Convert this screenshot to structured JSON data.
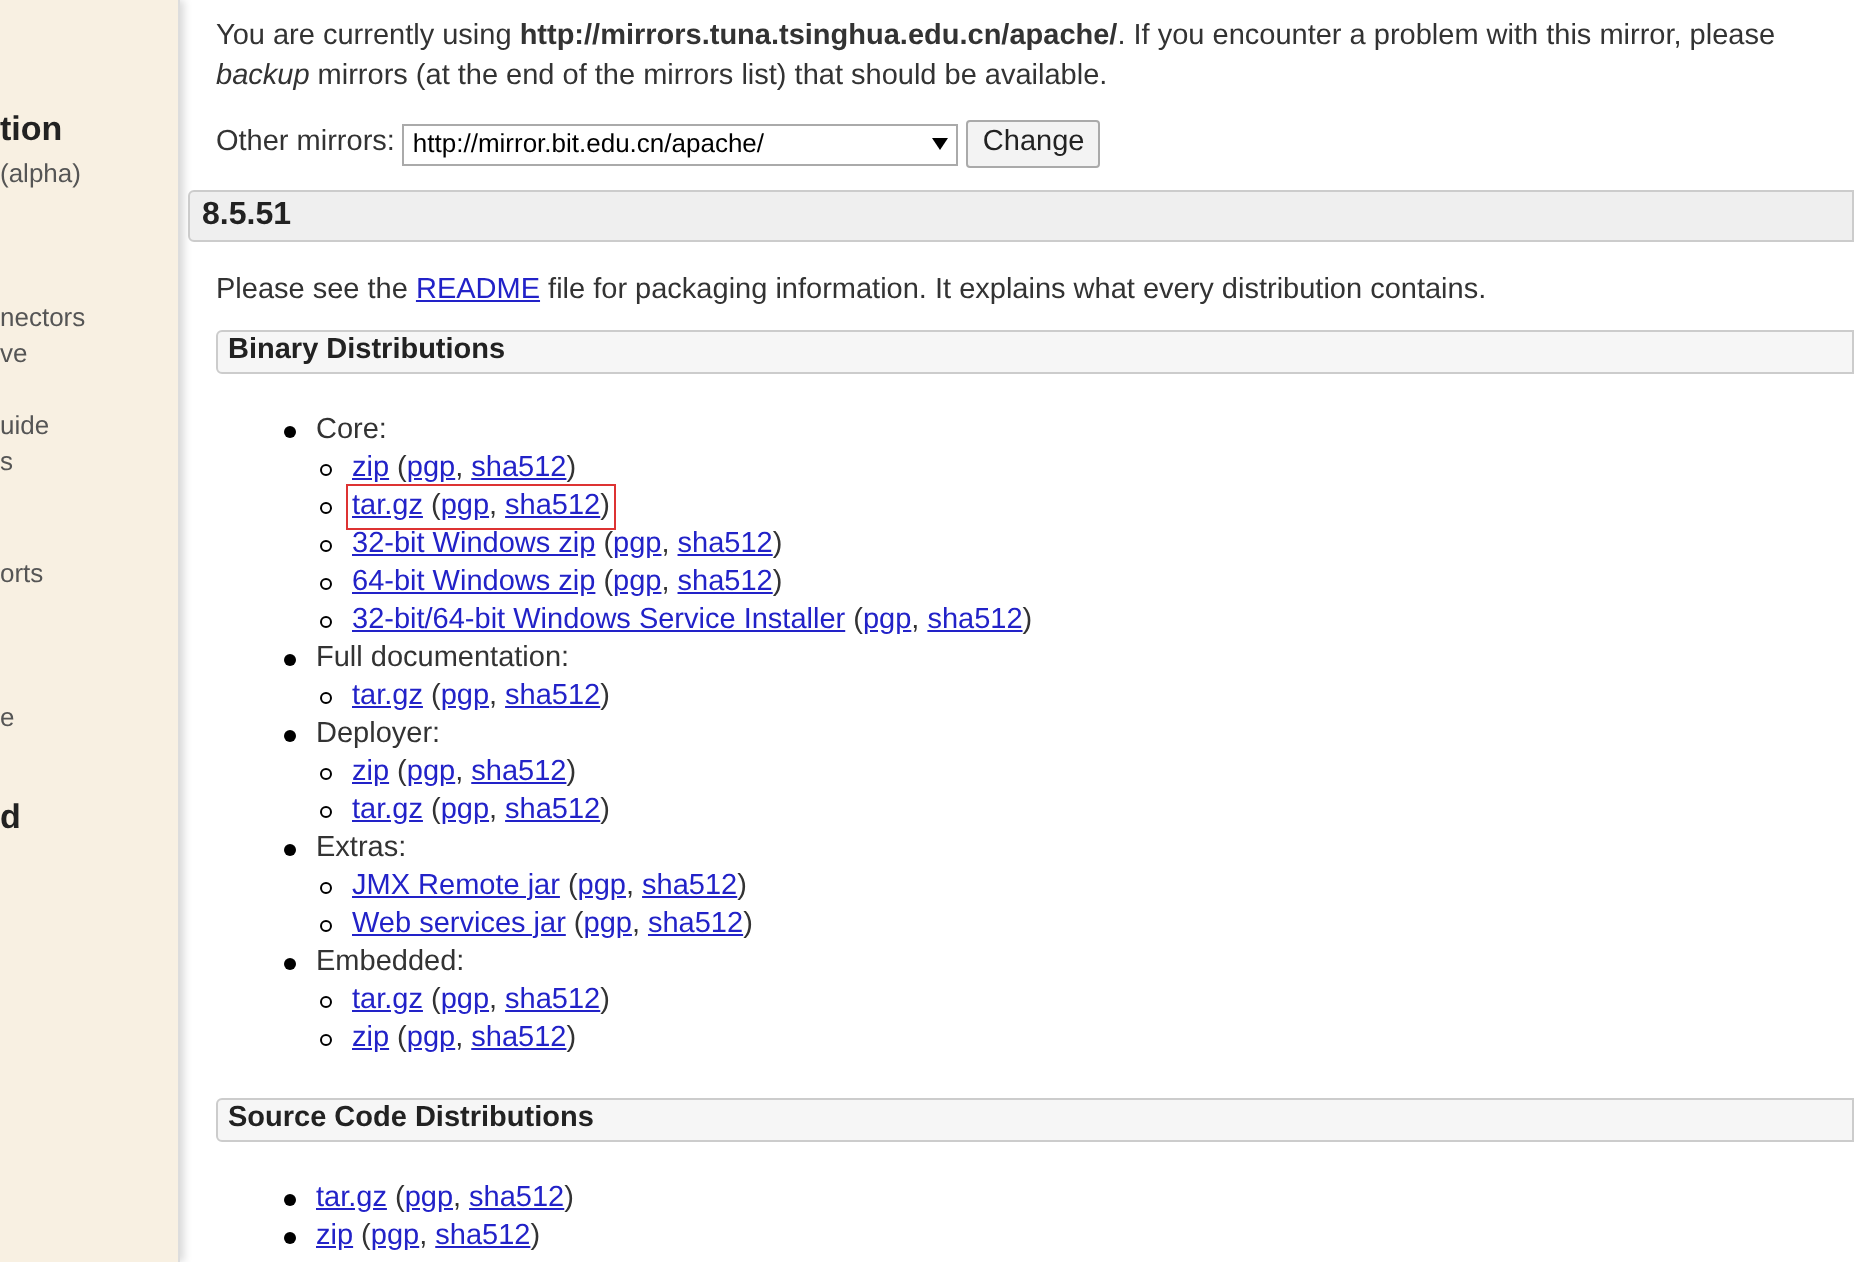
{
  "sidebar": {
    "items": [
      {
        "text": "tion",
        "kind": "heading"
      },
      {
        "text": "(alpha)",
        "kind": "link"
      },
      {
        "text": "nectors",
        "kind": "link"
      },
      {
        "text": "ve",
        "kind": "link"
      },
      {
        "text": "uide",
        "kind": "link"
      },
      {
        "text": "s",
        "kind": "link"
      },
      {
        "text": "orts",
        "kind": "link"
      },
      {
        "text": "e",
        "kind": "link"
      },
      {
        "text": "d",
        "kind": "heading"
      }
    ]
  },
  "intro": "You are currently using **http://mirrors.tuna.tsinghua.edu.cn/apache/**. If you encounter a problem with this mirror, please",
  "intro_2": "*backup* mirrors (at the end of the mirrors list) that should be available.",
  "mirror_select": {
    "label": "Other mirrors:",
    "value": "http://mirror.bit.edu.cn/apache/",
    "button": "Change"
  },
  "version": "8.5.51",
  "readme": {
    "before": "Please see the",
    "link": "README",
    "after": "file for packaging information. It explains what every distribution contains."
  },
  "sections": [
    {
      "title": "Binary Distributions",
      "groups": [
        {
          "label": "Core:",
          "files": [
            {
              "label": "zip",
              "open": "(",
              "links": [
                "pgp",
                "sha512"
              ],
              "separator": ",",
              "close": ")",
              "highlighted": false
            },
            {
              "label": "tar.gz",
              "open": "(",
              "links": [
                "pgp",
                "sha512"
              ],
              "separator": ",",
              "close": ")",
              "highlighted": true
            },
            {
              "label": "32-bit Windows zip",
              "open": "(",
              "links": [
                "pgp",
                "sha512"
              ],
              "separator": ",",
              "close": ")",
              "highlighted": false
            },
            {
              "label": "64-bit Windows zip",
              "open": "(",
              "links": [
                "pgp",
                "sha512"
              ],
              "separator": ",",
              "close": ")",
              "highlighted": false
            },
            {
              "label": "32-bit/64-bit Windows Service Installer",
              "open": "(",
              "links": [
                "pgp",
                "sha512"
              ],
              "separator": ",",
              "close": ")",
              "highlighted": false
            }
          ]
        },
        {
          "label": "Full documentation:",
          "files": [
            {
              "label": "tar.gz",
              "open": "(",
              "links": [
                "pgp",
                "sha512"
              ],
              "separator": ",",
              "close": ")",
              "highlighted": false
            }
          ]
        },
        {
          "label": "Deployer:",
          "files": [
            {
              "label": "zip",
              "open": "(",
              "links": [
                "pgp",
                "sha512"
              ],
              "separator": ",",
              "close": ")",
              "highlighted": false
            },
            {
              "label": "tar.gz",
              "open": "(",
              "links": [
                "pgp",
                "sha512"
              ],
              "separator": ",",
              "close": ")",
              "highlighted": false
            }
          ]
        },
        {
          "label": "Extras:",
          "files": [
            {
              "label": "JMX Remote jar",
              "open": "(",
              "links": [
                "pgp",
                "sha512"
              ],
              "separator": ",",
              "close": ")",
              "highlighted": false
            },
            {
              "label": "Web services jar",
              "open": "(",
              "links": [
                "pgp",
                "sha512"
              ],
              "separator": ",",
              "close": ")",
              "highlighted": false
            }
          ]
        },
        {
          "label": "Embedded:",
          "files": [
            {
              "label": "tar.gz",
              "open": "(",
              "links": [
                "pgp",
                "sha512"
              ],
              "separator": ",",
              "close": ")",
              "highlighted": false
            },
            {
              "label": "zip",
              "open": "(",
              "links": [
                "pgp",
                "sha512"
              ],
              "separator": ",",
              "close": ")",
              "highlighted": false
            }
          ]
        }
      ]
    },
    {
      "title": "Source Code Distributions",
      "files": [
        {
          "label": "tar.gz",
          "open": "(",
          "links": [
            "pgp",
            "sha512"
          ],
          "separator": ",",
          "close": ")",
          "highlighted": false
        },
        {
          "label": "zip",
          "open": "(",
          "links": [
            "pgp",
            "sha512"
          ],
          "separator": ",",
          "close": ")",
          "highlighted": false
        }
      ]
    }
  ]
}
